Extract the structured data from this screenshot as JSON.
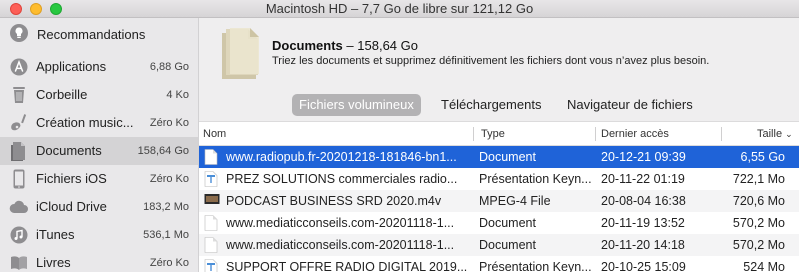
{
  "window": {
    "title": "Macintosh HD – 7,7 Go de libre sur 121,12 Go"
  },
  "sidebar": {
    "recommendations": {
      "label": "Recommandations",
      "icon": "lightbulb-icon"
    },
    "items": [
      {
        "label": "Applications",
        "size": "6,88 Go",
        "icon": "applications-icon"
      },
      {
        "label": "Corbeille",
        "size": "4 Ko",
        "icon": "trash-icon"
      },
      {
        "label": "Création music...",
        "size": "Zéro Ko",
        "icon": "guitar-icon"
      },
      {
        "label": "Documents",
        "size": "158,64 Go",
        "icon": "document-icon",
        "selected": true
      },
      {
        "label": "Fichiers iOS",
        "size": "Zéro Ko",
        "icon": "iphone-icon"
      },
      {
        "label": "iCloud Drive",
        "size": "183,2 Mo",
        "icon": "cloud-icon"
      },
      {
        "label": "iTunes",
        "size": "536,1 Mo",
        "icon": "music-note-icon"
      },
      {
        "label": "Livres",
        "size": "Zéro Ko",
        "icon": "book-icon"
      }
    ]
  },
  "header": {
    "title": "Documents",
    "size": "– 158,64 Go",
    "description": "Triez les documents et supprimez définitivement les fichiers dont vous n’avez plus besoin."
  },
  "tabs": [
    {
      "label": "Fichiers volumineux",
      "active": true
    },
    {
      "label": "Téléchargements",
      "active": false
    },
    {
      "label": "Navigateur de fichiers",
      "active": false
    }
  ],
  "table": {
    "columns": {
      "name": "Nom",
      "type": "Type",
      "date": "Dernier accès",
      "size": "Taille"
    },
    "sort_indicator": "chevron-down-icon",
    "rows": [
      {
        "name": "www.radiopub.fr-20201218-181846-bn1...",
        "type": "Document",
        "date": "20-12-21 09:39",
        "size": "6,55 Go",
        "icon": "document-file-icon",
        "selected": true
      },
      {
        "name": "PREZ  SOLUTIONS commerciales radio...",
        "type": "Présentation Keyn...",
        "date": "20-11-22 01:19",
        "size": "722,1 Mo",
        "icon": "keynote-file-icon"
      },
      {
        "name": "PODCAST BUSINESS SRD 2020.m4v",
        "type": "MPEG-4 File",
        "date": "20-08-04 16:38",
        "size": "720,6 Mo",
        "icon": "video-file-icon"
      },
      {
        "name": "www.mediaticconseils.com-20201118-1...",
        "type": "Document",
        "date": "20-11-19 13:52",
        "size": "570,2 Mo",
        "icon": "document-file-icon"
      },
      {
        "name": "www.mediaticconseils.com-20201118-1...",
        "type": "Document",
        "date": "20-11-20 14:18",
        "size": "570,2 Mo",
        "icon": "document-file-icon"
      },
      {
        "name": "SUPPORT OFFRE RADIO DIGITAL 2019...",
        "type": "Présentation Keyn...",
        "date": "20-10-25 15:09",
        "size": "524 Mo",
        "icon": "keynote-file-icon"
      }
    ]
  },
  "colors": {
    "selection": "#1f63d8",
    "sidebar_bg": "#e9e8ea",
    "active_tab": "#b3b2b4"
  }
}
